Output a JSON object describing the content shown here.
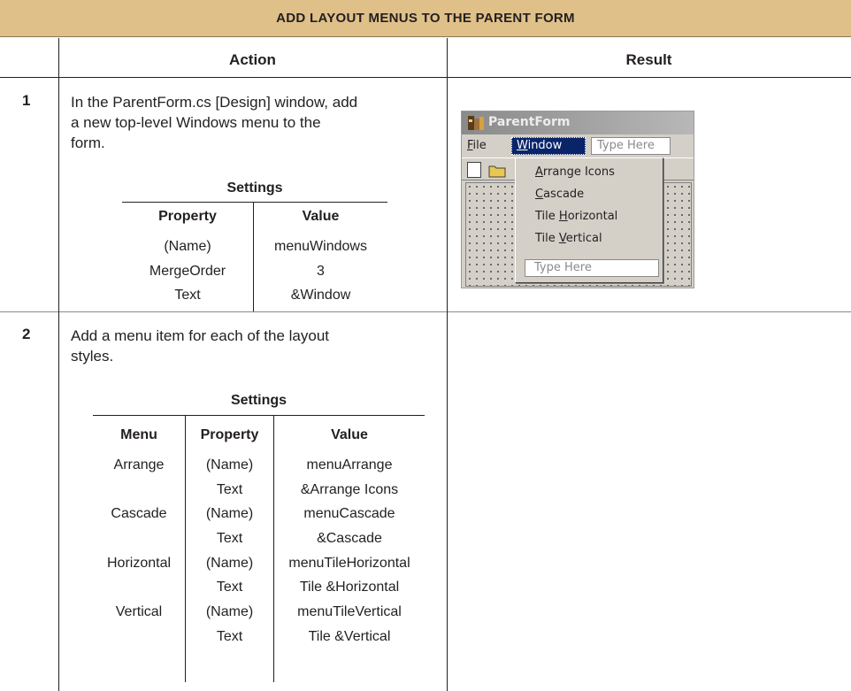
{
  "banner": {
    "title": "ADD LAYOUT MENUS TO THE PARENT FORM"
  },
  "header": {
    "action": "Action",
    "result": "Result"
  },
  "steps": [
    {
      "number": "1",
      "lines": [
        "In the ParentForm.cs [Design] window, add",
        "a new top-level Windows menu to the",
        "form."
      ],
      "settings_title": "Settings",
      "columns": [
        "Property",
        "Value"
      ],
      "rows": [
        [
          "(Name)",
          "menuWindows"
        ],
        [
          "MergeOrder",
          "3"
        ],
        [
          "Text",
          "&Window"
        ]
      ]
    },
    {
      "number": "2",
      "lines": [
        "Add a menu item for each of the layout",
        "styles."
      ],
      "settings_title": "Settings",
      "columns": [
        "Menu",
        "Property",
        "Value"
      ],
      "rows": [
        [
          "Arrange",
          "(Name)",
          "menuArrange"
        ],
        [
          "",
          "Text",
          "&Arrange Icons"
        ],
        [
          "Cascade",
          "(Name)",
          "menuCascade"
        ],
        [
          "",
          "Text",
          "&Cascade"
        ],
        [
          "Horizontal",
          "(Name)",
          "menuTileHorizontal"
        ],
        [
          "",
          "Text",
          "Tile &Horizontal"
        ],
        [
          "Vertical",
          "(Name)",
          "menuTileVertical"
        ],
        [
          "",
          "Text",
          "Tile &Vertical"
        ]
      ]
    }
  ],
  "screenshot": {
    "window_title": "ParentForm",
    "menu": {
      "file": "File",
      "window": "Window",
      "type_here": "Type Here"
    },
    "dropdown": [
      "Arrange Icons",
      "Cascade",
      "Tile Horizontal",
      "Tile Vertical"
    ],
    "dropdown_type_here": "Type Here",
    "icons": [
      "app-icon",
      "new-file-icon",
      "open-folder-icon"
    ],
    "colors": {
      "title_bar": "#8a8a8a",
      "menu_highlight": "#0a246a",
      "face": "#d4d0c8"
    }
  },
  "colors": {
    "banner": "#dfc089"
  }
}
